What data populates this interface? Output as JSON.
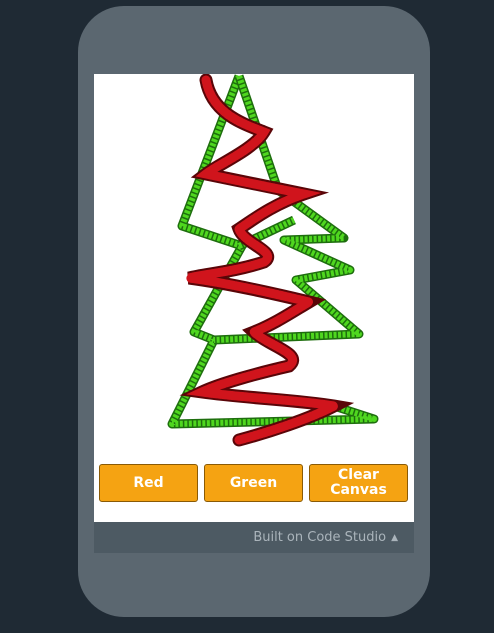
{
  "buttons": {
    "red": "Red",
    "green": "Green",
    "clear": "Clear Canvas"
  },
  "footer": {
    "text": "Built on Code Studio",
    "arrow_icon": "triangle-up-icon"
  },
  "colors": {
    "background": "#1f2a34",
    "phone": "#5b6770",
    "button": "#f5a312",
    "footer": "#4d5a63",
    "tree_green": "#44cc1c",
    "tree_red": "#c0121a"
  }
}
